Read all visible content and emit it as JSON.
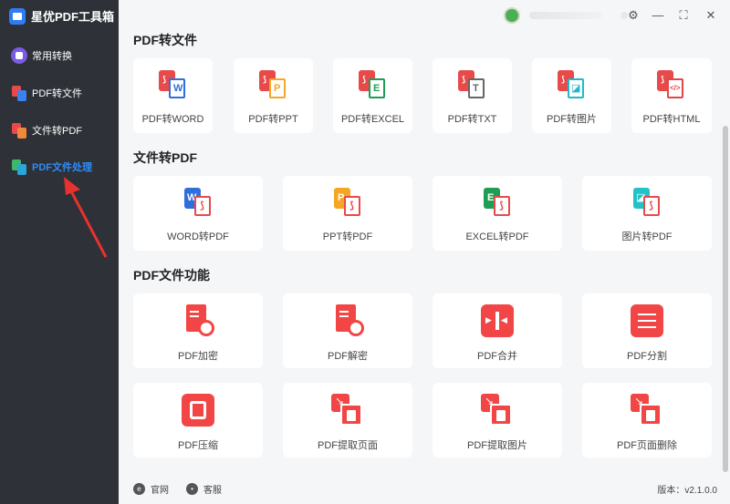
{
  "app": {
    "title": "星优PDF工具箱"
  },
  "sidebar": {
    "items": [
      {
        "label": "常用转换",
        "active": false
      },
      {
        "label": "PDF转文件",
        "active": false
      },
      {
        "label": "文件转PDF",
        "active": false
      },
      {
        "label": "PDF文件处理",
        "active": true
      }
    ]
  },
  "sections": [
    {
      "title": "PDF转文件",
      "cards": [
        {
          "label": "PDF转WORD",
          "icon": "pdf-to-word-icon",
          "color": "#2f6fdc"
        },
        {
          "label": "PDF转PPT",
          "icon": "pdf-to-ppt-icon",
          "color": "#f5a623"
        },
        {
          "label": "PDF转EXCEL",
          "icon": "pdf-to-excel-icon",
          "color": "#1f9d55"
        },
        {
          "label": "PDF转TXT",
          "icon": "pdf-to-txt-icon",
          "color": "#666666"
        },
        {
          "label": "PDF转图片",
          "icon": "pdf-to-image-icon",
          "color": "#22b8c8"
        },
        {
          "label": "PDF转HTML",
          "icon": "pdf-to-html-icon",
          "color": "#e04848"
        }
      ]
    },
    {
      "title": "文件转PDF",
      "cards": [
        {
          "label": "WORD转PDF",
          "icon": "word-to-pdf-icon",
          "color": "#2f6fdc"
        },
        {
          "label": "PPT转PDF",
          "icon": "ppt-to-pdf-icon",
          "color": "#f5a623"
        },
        {
          "label": "EXCEL转PDF",
          "icon": "excel-to-pdf-icon",
          "color": "#1f9d55"
        },
        {
          "label": "图片转PDF",
          "icon": "image-to-pdf-icon",
          "color": "#22c3c8"
        }
      ]
    },
    {
      "title": "PDF文件功能",
      "cards": [
        {
          "label": "PDF加密",
          "icon": "pdf-encrypt-icon"
        },
        {
          "label": "PDF解密",
          "icon": "pdf-decrypt-icon"
        },
        {
          "label": "PDF合并",
          "icon": "pdf-merge-icon"
        },
        {
          "label": "PDF分割",
          "icon": "pdf-split-icon"
        },
        {
          "label": "PDF压缩",
          "icon": "pdf-compress-icon"
        },
        {
          "label": "PDF提取页面",
          "icon": "pdf-extract-pages-icon"
        },
        {
          "label": "PDF提取图片",
          "icon": "pdf-extract-images-icon"
        },
        {
          "label": "PDF页面删除",
          "icon": "pdf-delete-pages-icon"
        }
      ]
    }
  ],
  "footer": {
    "website": "官网",
    "support": "客服",
    "version": "版本：v2.1.0.0"
  },
  "colors": {
    "accent": "#2f8df6",
    "pdf_red": "#f24646",
    "sidebar_bg": "#2e3138"
  }
}
